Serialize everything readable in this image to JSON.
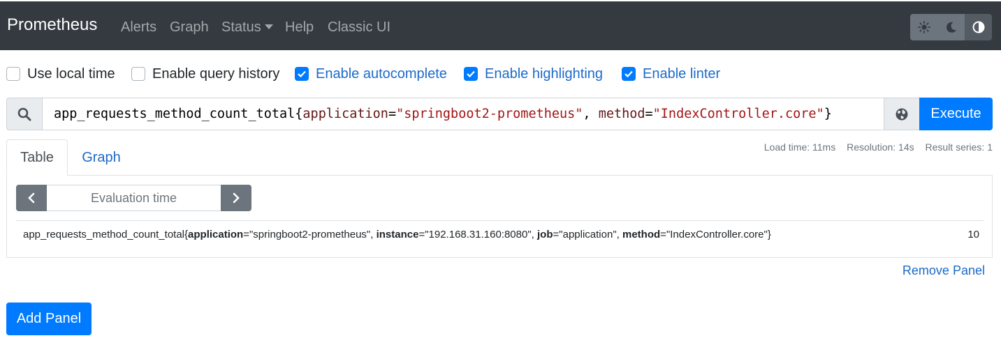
{
  "navbar": {
    "brand": "Prometheus",
    "links": [
      "Alerts",
      "Graph",
      "Status",
      "Help",
      "Classic UI"
    ],
    "theme_buttons": [
      "sun-icon",
      "moon-icon",
      "adjust-icon"
    ],
    "active_theme": "adjust-icon"
  },
  "options": [
    {
      "label": "Use local time",
      "checked": false
    },
    {
      "label": "Enable query history",
      "checked": false
    },
    {
      "label": "Enable autocomplete",
      "checked": true
    },
    {
      "label": "Enable highlighting",
      "checked": true
    },
    {
      "label": "Enable linter",
      "checked": true
    }
  ],
  "query": {
    "metric": "app_requests_method_count_total",
    "matchers": [
      {
        "label": "application",
        "op": "=",
        "value": "\"springboot2-prometheus\""
      },
      {
        "label": "method",
        "op": "=",
        "value": "\"IndexController.core\""
      }
    ],
    "execute_label": "Execute"
  },
  "tabs": {
    "items": [
      "Table",
      "Graph"
    ],
    "active": "Table"
  },
  "stats": {
    "load_time": "Load time: 11ms",
    "resolution": "Resolution: 14s",
    "result_series": "Result series: 1"
  },
  "table": {
    "evaluation_time_placeholder": "Evaluation time",
    "rows": [
      {
        "metric": "app_requests_method_count_total",
        "labels": [
          {
            "name": "application",
            "value": "\"springboot2-prometheus\""
          },
          {
            "name": "instance",
            "value": "\"192.168.31.160:8080\""
          },
          {
            "name": "job",
            "value": "\"application\""
          },
          {
            "name": "method",
            "value": "\"IndexController.core\""
          }
        ],
        "value": "10"
      }
    ]
  },
  "remove_panel": "Remove Panel",
  "add_panel": "Add Panel",
  "colors": {
    "navbar_bg": "#343a40",
    "primary": "#007bff",
    "link": "#1b6ac9",
    "secondary": "#6c757d",
    "string": "#a31515"
  }
}
